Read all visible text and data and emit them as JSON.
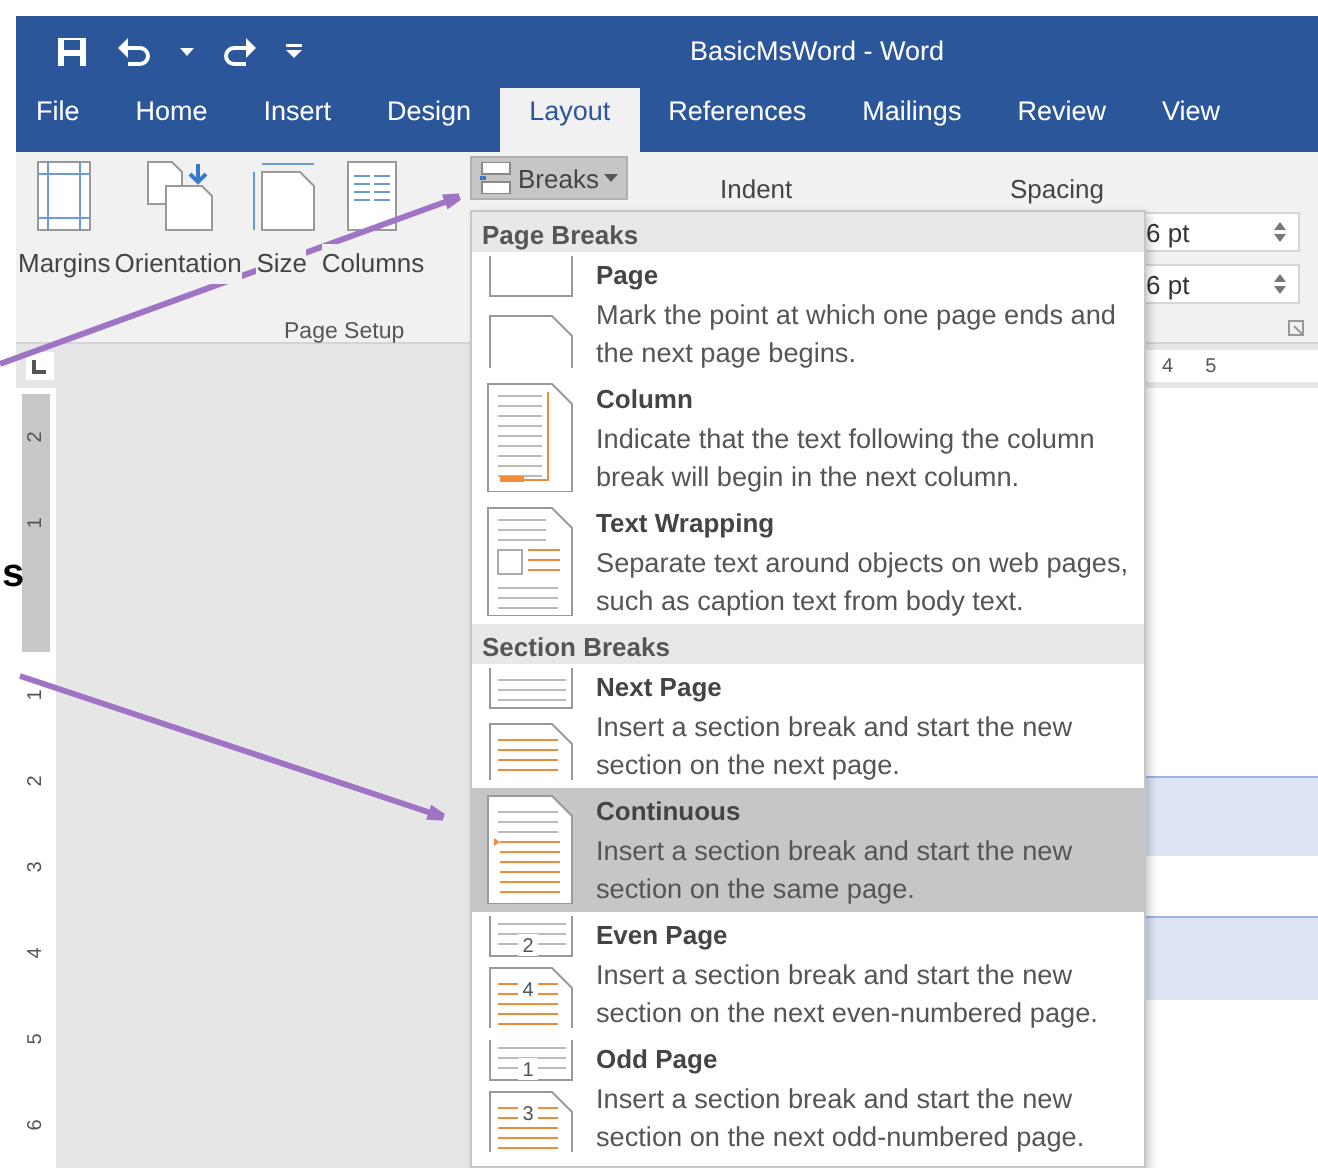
{
  "window": {
    "title": "BasicMsWord  -  Word"
  },
  "tabs": [
    {
      "label": "File",
      "selected": false
    },
    {
      "label": "Home",
      "selected": false
    },
    {
      "label": "Insert",
      "selected": false
    },
    {
      "label": "Design",
      "selected": false
    },
    {
      "label": "Layout",
      "selected": true
    },
    {
      "label": "References",
      "selected": false
    },
    {
      "label": "Mailings",
      "selected": false
    },
    {
      "label": "Review",
      "selected": false
    },
    {
      "label": "View",
      "selected": false
    }
  ],
  "page_setup": {
    "buttons": [
      {
        "label": "Margins",
        "kind": "margins"
      },
      {
        "label": "Orientation",
        "kind": "orientation"
      },
      {
        "label": "Size",
        "kind": "size"
      },
      {
        "label": "Columns",
        "kind": "columns"
      }
    ],
    "breaks_button": {
      "label": "Breaks",
      "open": true
    },
    "group_label": "Page Setup"
  },
  "paragraph": {
    "indent_label": "Indent",
    "spacing_label": "Spacing",
    "spacing_values": [
      "6 pt",
      "6 pt"
    ]
  },
  "breaks_menu": [
    {
      "heading": "Page Breaks",
      "items": [
        {
          "kind": "page",
          "title": "Page",
          "description": "Mark the point at which one page ends and the next page begins.",
          "selected": false
        },
        {
          "kind": "column",
          "title": "Column",
          "description": "Indicate that the text following the column break will begin in the next column.",
          "selected": false
        },
        {
          "kind": "text-wrapping",
          "title": "Text Wrapping",
          "description": "Separate text around objects on web pages, such as caption text from body text.",
          "selected": false
        }
      ]
    },
    {
      "heading": "Section Breaks",
      "items": [
        {
          "kind": "next-page",
          "title": "Next Page",
          "description": "Insert a section break and start the new section on the next page.",
          "selected": false
        },
        {
          "kind": "continuous",
          "title": "Continuous",
          "description": "Insert a section break and start the new section on the same page.",
          "selected": true
        },
        {
          "kind": "even-page",
          "title": "Even Page",
          "description": "Insert a section break and start the new section on the next even-numbered page.",
          "selected": false,
          "icon_numbers": [
            "2",
            "4"
          ]
        },
        {
          "kind": "odd-page",
          "title": "Odd Page",
          "description": "Insert a section break and start the new section on the next odd-numbered page.",
          "selected": false,
          "icon_numbers": [
            "1",
            "3"
          ]
        }
      ]
    }
  ],
  "vertical_ruler": [
    "2",
    "1",
    "1",
    "2",
    "3",
    "4",
    "5",
    "6"
  ],
  "horizontal_ruler": [
    "4",
    "5"
  ],
  "slide_text": "s"
}
